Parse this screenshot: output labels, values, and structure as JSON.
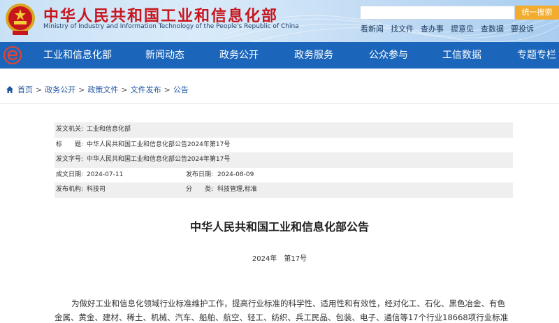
{
  "header": {
    "title": "中华人民共和国工业和信息化部",
    "subtitle": "Ministry of Industry and Information Technology of the People's Republic of China",
    "search": {
      "placeholder": "",
      "button_label": "统一搜索"
    },
    "quick_links": [
      "看新闻",
      "找文件",
      "查办事",
      "提意见",
      "查数据",
      "要投诉"
    ]
  },
  "nav": {
    "items": [
      "工业和信息化部",
      "新闻动态",
      "政务公开",
      "政务服务",
      "公众参与",
      "工信数据",
      "专题专栏"
    ]
  },
  "breadcrumb": [
    "首页",
    "政务公开",
    "政策文件",
    "文件发布",
    "公告"
  ],
  "meta": {
    "issuer_label": "发文机关:",
    "issuer": "工业和信息化部",
    "title_label": "标　　题:",
    "title": "中华人民共和国工业和信息化部公告2024年第17号",
    "doc_no_label": "发文字号:",
    "doc_no": "中华人民共和国工业和信息化部公告2024年第17号",
    "created_label": "成文日期:",
    "created": "2024-07-11",
    "published_label": "发布日期:",
    "published": "2024-08-09",
    "agency_label": "发布机构:",
    "agency": "科技司",
    "category_label": "分　　类:",
    "category": "科技管理,标准"
  },
  "article": {
    "title": "中华人民共和国工业和信息化部公告",
    "number": "2024年　第17号",
    "body": "为做好工业和信息化领域行业标准维护工作，提高行业标准的科学性、适用性和有效性，经对化工、石化、黑色冶金、有色金属、黄金、建材、稀土、机械、汽车、船舶、航空、轻工、纺织、兵工民品、包装、电子、通信等17个行业18668项行业标准"
  },
  "colors": {
    "brand_red": "#c8161d",
    "nav_blue": "#1b66bb",
    "search_orange": "#f3ac2d",
    "link_blue": "#2457a3"
  },
  "icons": {
    "home": "home-icon",
    "emblem": "national-emblem-icon",
    "site_logo": "miit-logo-icon"
  }
}
